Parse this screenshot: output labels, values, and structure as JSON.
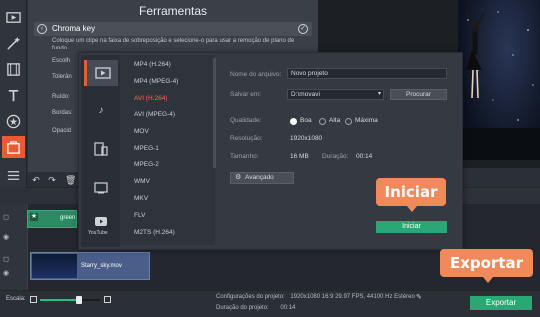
{
  "tools_panel": {
    "title": "Ferramentas",
    "chroma_key_title": "Chroma key",
    "chroma_key_desc": "Coloque um clipe na faixa de sobreposição e selecione-o para usar a remoção de plano de fundo.",
    "side_labels": [
      "Escolh",
      "Tolerân",
      "Ruído:",
      "Bordas:",
      "Opacid"
    ]
  },
  "timeline": {
    "clip_green_name": "green",
    "clip_sky_name": "Starry_sky.mov"
  },
  "bottom_bar": {
    "scale_label": "Escala:",
    "project_settings_label": "Configurações do projeto:",
    "project_settings_value": "1920x1080 16:9 29.97 FPS, 44100 Hz Estéreo",
    "project_duration_label": "Duração do projeto:",
    "project_duration_value": "00:14",
    "export_label": "Exportar",
    "scale_level": 0.63
  },
  "export_dialog": {
    "categories": [
      {
        "icon": "monitor-video-icon",
        "active": true
      },
      {
        "icon": "music-note-icon",
        "active": false
      },
      {
        "icon": "devices-icon",
        "active": false
      },
      {
        "icon": "tv-icon",
        "active": false
      },
      {
        "icon": "youtube-icon",
        "active": false,
        "label": "YouTube"
      }
    ],
    "formats": [
      "MP4 (H.264)",
      "MP4 (MPEG-4)",
      "AVI (H.264)",
      "AVI (MPEG-4)",
      "MOV",
      "MPEG-1",
      "MPEG-2",
      "WMV",
      "MKV",
      "FLV",
      "M2TS (H.264)"
    ],
    "selected_format": "AVI (H.264)",
    "filename_label": "Nome do arquivo:",
    "filename_value": "Novo projeto",
    "save_in_label": "Salvar em:",
    "save_in_value": "D:\\movavi",
    "browse_label": "Procurar",
    "quality_label": "Qualidade:",
    "quality_options": [
      "Boa",
      "Alta",
      "Máxima"
    ],
    "quality_selected": "Boa",
    "resolution_label": "Resolução:",
    "resolution_value": "1920x1080",
    "size_label": "Tamanho:",
    "size_value": "16 MB",
    "duration_label": "Duração:",
    "duration_value": "00:14",
    "advanced_label": "Avançado",
    "start_label": "Iniciar"
  },
  "callouts": {
    "start": "Iniciar",
    "export": "Exportar"
  },
  "colors": {
    "accent_orange": "#e85c33",
    "callout": "#f08a5d",
    "green_button": "#2aa873",
    "selected_format": "#ff6b4a"
  }
}
